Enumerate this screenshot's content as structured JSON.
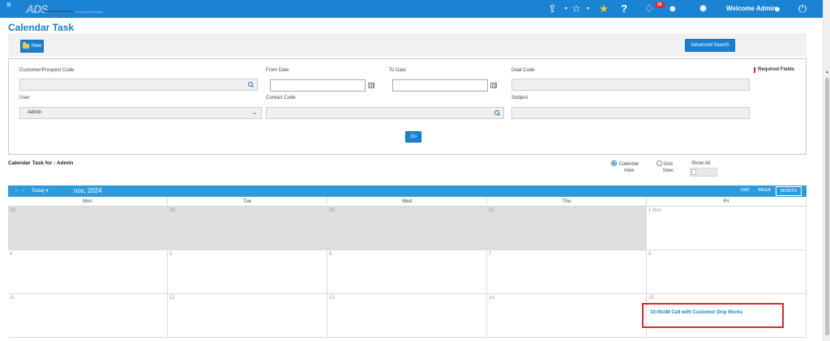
{
  "topbar": {
    "logo_text": "ADS",
    "logo_tagline": "CLOUD ERP SOFTWARE",
    "notification_count": "20",
    "welcome": "Welcome Admin"
  },
  "page": {
    "title": "Calendar Task"
  },
  "toolbar": {
    "new_label": "New",
    "advanced_search_label": "Advanced Search"
  },
  "filters": {
    "customer_label": "Customer/Prospect Code",
    "customer_value": "",
    "from_date_label": "From Date",
    "from_date_value": "",
    "to_date_label": "To Date",
    "to_date_value": "",
    "deal_code_label": "Deal Code",
    "deal_code_value": "",
    "required_fields": "Required Fields",
    "user_label": "User",
    "user_value": "Admin",
    "contact_code_label": "Contact Code",
    "contact_code_value": "",
    "subject_label": "Subject",
    "subject_value": "",
    "go_label": "Go"
  },
  "calendar_header": {
    "for_label": "Calendar Task for : Admin",
    "calendar_view": "Calendar View",
    "grid_view": "Grid View",
    "selected_view": "Calendar View",
    "show_all": "Show All",
    "show_all_on": false
  },
  "calendar": {
    "today_label": "Today",
    "month_label": "nov, 2024",
    "views": [
      "DAY",
      "WEEK",
      "MONTH"
    ],
    "active_view": "MONTH",
    "days": [
      "Mon",
      "Tue",
      "Wed",
      "Thu",
      "Fri"
    ],
    "weeks": [
      [
        "28",
        "29",
        "30",
        "31",
        "1 Nov"
      ],
      [
        "4",
        "5",
        "6",
        "7",
        "8"
      ],
      [
        "11",
        "12",
        "13",
        "14",
        "15"
      ]
    ],
    "events": [
      {
        "day": "15",
        "text": "10:00AM Call with Customer Drip Works"
      }
    ]
  },
  "colors": {
    "brand_blue": "#1a83d4",
    "calendar_bar": "#2c9bdc",
    "highlight_red": "#e3262b",
    "outside_month_grey": "#dedede"
  }
}
